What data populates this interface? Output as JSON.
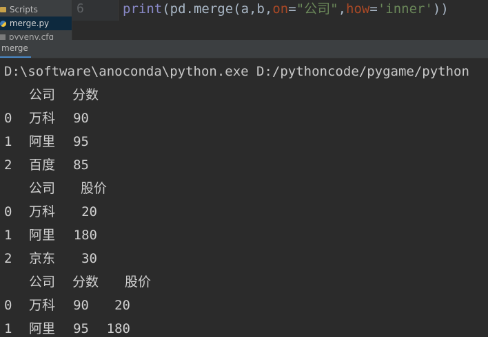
{
  "project_tree": {
    "items": [
      {
        "label": "Scripts"
      },
      {
        "label": "merge.py"
      },
      {
        "label": "pyvenv.cfg"
      }
    ]
  },
  "editor": {
    "line_number": "6",
    "code_tokens": [
      {
        "text": "print",
        "kind": "fn"
      },
      {
        "text": "(pd.merge(a,b,",
        "kind": "p"
      },
      {
        "text": "on",
        "kind": "kw"
      },
      {
        "text": "=",
        "kind": "p"
      },
      {
        "text": "\"公司\"",
        "kind": "str"
      },
      {
        "text": ",",
        "kind": "p"
      },
      {
        "text": "how",
        "kind": "kw"
      },
      {
        "text": "=",
        "kind": "p"
      },
      {
        "text": "'inner'",
        "kind": "str"
      },
      {
        "text": "))",
        "kind": "p"
      }
    ]
  },
  "run_window": {
    "tab_label": "merge"
  },
  "console": {
    "command": "D:\\software\\anoconda\\python.exe D:/pythoncode/pygame/python",
    "table1": {
      "headers": [
        "公司",
        "分数"
      ],
      "rows": [
        {
          "idx": "0",
          "cols": [
            "万科",
            "90"
          ]
        },
        {
          "idx": "1",
          "cols": [
            "阿里",
            "95"
          ]
        },
        {
          "idx": "2",
          "cols": [
            "百度",
            "85"
          ]
        }
      ]
    },
    "table2": {
      "headers": [
        "公司",
        "股价"
      ],
      "rows": [
        {
          "idx": "0",
          "cols": [
            "万科",
            "20"
          ]
        },
        {
          "idx": "1",
          "cols": [
            "阿里",
            "180"
          ]
        },
        {
          "idx": "2",
          "cols": [
            "京东",
            "30"
          ]
        }
      ]
    },
    "table3": {
      "headers": [
        "公司",
        "分数",
        "股价"
      ],
      "rows": [
        {
          "idx": "0",
          "cols": [
            "万科",
            "90",
            "20"
          ]
        },
        {
          "idx": "1",
          "cols": [
            "阿里",
            "95",
            "180"
          ]
        }
      ]
    }
  },
  "colors": {
    "console_bg": "#2b2b2b",
    "panel_bg": "#3c3f41",
    "selection": "#0d293e",
    "accent_tab": "#4a88c7"
  }
}
